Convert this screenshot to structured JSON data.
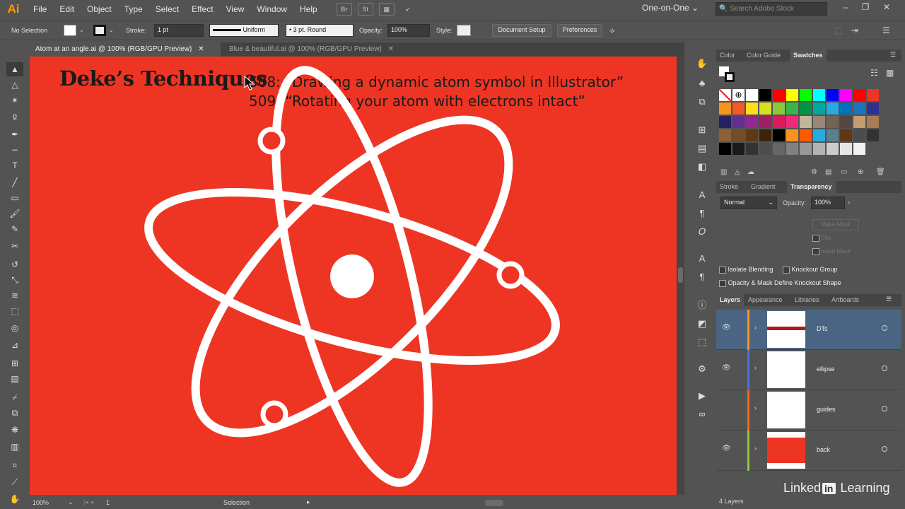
{
  "app": {
    "logo": "Ai",
    "workspace": "One-on-One",
    "search_placeholder": "Search Adobe Stock"
  },
  "menu": [
    "File",
    "Edit",
    "Object",
    "Type",
    "Select",
    "Effect",
    "View",
    "Window",
    "Help"
  ],
  "menu_buttons": [
    "Br",
    "St"
  ],
  "control": {
    "selection": "No Selection",
    "stroke_label": "Stroke:",
    "stroke_value": "1 pt",
    "profile": "Uniform",
    "brush": "3 pt. Round",
    "opacity_label": "Opacity:",
    "opacity_value": "100%",
    "style_label": "Style:",
    "document_setup": "Document Setup",
    "preferences": "Preferences"
  },
  "tabs": [
    {
      "label": "Atom at an angle.ai @ 100% (RGB/GPU Preview)"
    },
    {
      "label": "Blue & beautiful.ai @ 100% (RGB/GPU Preview)"
    }
  ],
  "artboard": {
    "title": "Deke’s Techniques",
    "line1": "508: “Drawing a dynamic atom symbol in Illustrator”",
    "line2": "509: “Rotating your atom with electrons intact”",
    "background": "#ee3524"
  },
  "status": {
    "zoom": "100%",
    "artboard_num": "1",
    "tool": "Selection"
  },
  "swatches_panel": {
    "tabs": [
      "Color",
      "Color Guide",
      "Swatches"
    ],
    "rows": [
      [
        "none",
        "reg",
        "#ffffff",
        "#000000",
        "#ff0000",
        "#ffff00",
        "#00ff00",
        "#00ffff",
        "#0000ff",
        "#ff00ff",
        "#ff0000",
        "#ee3524"
      ],
      [
        "#f7941d",
        "#f15a24",
        "#ffde17",
        "#d7df23",
        "#8dc63f",
        "#39b54a",
        "#009444",
        "#00a79d",
        "#27aae1",
        "#0072bc",
        "#1c75bc",
        "#2e3192"
      ],
      [
        "#262262",
        "#662d91",
        "#92278f",
        "#9e1f63",
        "#da1c5c",
        "#ee2a7b",
        "#c2b59b",
        "#998675",
        "#736357",
        "#534741",
        "#c69c6d",
        "#a67c52"
      ],
      [
        "#8c6239",
        "#754c24",
        "#603813",
        "#42210b",
        "#000000",
        "#f7931e",
        "#ff5a00",
        "#29abe2",
        "#5b7f91",
        "#603813",
        "#4c4c4c",
        "#333333"
      ],
      [
        "#000000",
        "#1a1a1a",
        "#333333",
        "#4d4d4d",
        "#666666",
        "#808080",
        "#999999",
        "#b3b3b3",
        "#cccccc",
        "#e6e6e6",
        "#f2f2f2"
      ]
    ]
  },
  "transparency_panel": {
    "tabs": [
      "Stroke",
      "Gradient",
      "Transparency"
    ],
    "blend_mode": "Normal",
    "opacity_label": "Opacity:",
    "opacity_value": "100%",
    "make_mask": "Make Mask",
    "clip": "Clip",
    "invert_mask": "Invert Mask",
    "isolate_blending": "Isolate Blending",
    "knockout_group": "Knockout Group",
    "opacity_mask": "Opacity & Mask Define Knockout Shape"
  },
  "layers_panel": {
    "tabs": [
      "Layers",
      "Appearance",
      "Libraries",
      "Artboards"
    ],
    "layers": [
      {
        "name": "DTs",
        "color": "#f7941d"
      },
      {
        "name": "ellipse",
        "color": "#4f6fd8"
      },
      {
        "name": "guides",
        "color": "#f26522"
      },
      {
        "name": "back",
        "color": "#8dc63f"
      }
    ],
    "count": "4 Layers"
  },
  "watermark": {
    "brand_a": "Linked",
    "brand_b": "in",
    "brand_c": " Learning"
  }
}
